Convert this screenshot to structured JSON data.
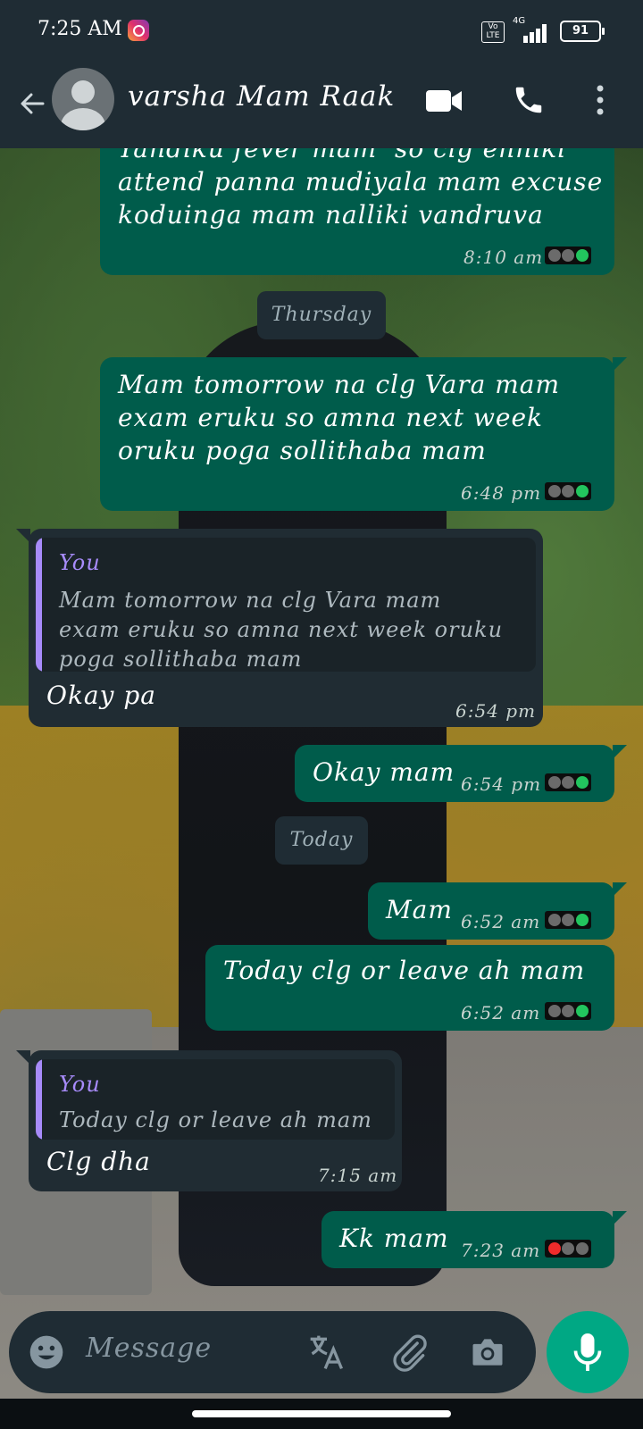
{
  "status_bar": {
    "time": "7:25 AM",
    "volte": "Vo LTE",
    "network": "4G",
    "battery": "91"
  },
  "header": {
    "contact_name": "varsha Mam Raak"
  },
  "chat": {
    "msg1": {
      "text": "Yandiku fever mam  so clg enniki\nattend panna mudiyala mam excuse\nkoduinga mam nalliki vandruva",
      "time": "8:10 am"
    },
    "date_thursday": "Thursday",
    "msg2": {
      "text": "Mam tomorrow na clg Vara mam\nexam eruku so amna next week\noruku poga sollithaba mam",
      "time": "6:48 pm"
    },
    "msg3": {
      "quote_name": "You",
      "quote_text": "Mam tomorrow na clg Vara mam\nexam eruku so amna next week oruku\npoga sollithaba mam",
      "text": "Okay pa",
      "time": "6:54 pm"
    },
    "msg4": {
      "text": "Okay mam",
      "time": "6:54 pm"
    },
    "date_today": "Today",
    "msg5": {
      "text": "Mam",
      "time": "6:52 am"
    },
    "msg6": {
      "text": "Today clg or leave ah mam",
      "time": "6:52 am"
    },
    "msg7": {
      "quote_name": "You",
      "quote_text": "Today clg or leave ah mam",
      "text": "Clg dha",
      "time": "7:15 am"
    },
    "msg8": {
      "text": "Kk mam",
      "time": "7:23 am"
    }
  },
  "tick_colors": {
    "read": "#22c55e",
    "delivered": "#6b6b6b",
    "unread": "#ef2b2b"
  },
  "input": {
    "placeholder": "Message"
  }
}
